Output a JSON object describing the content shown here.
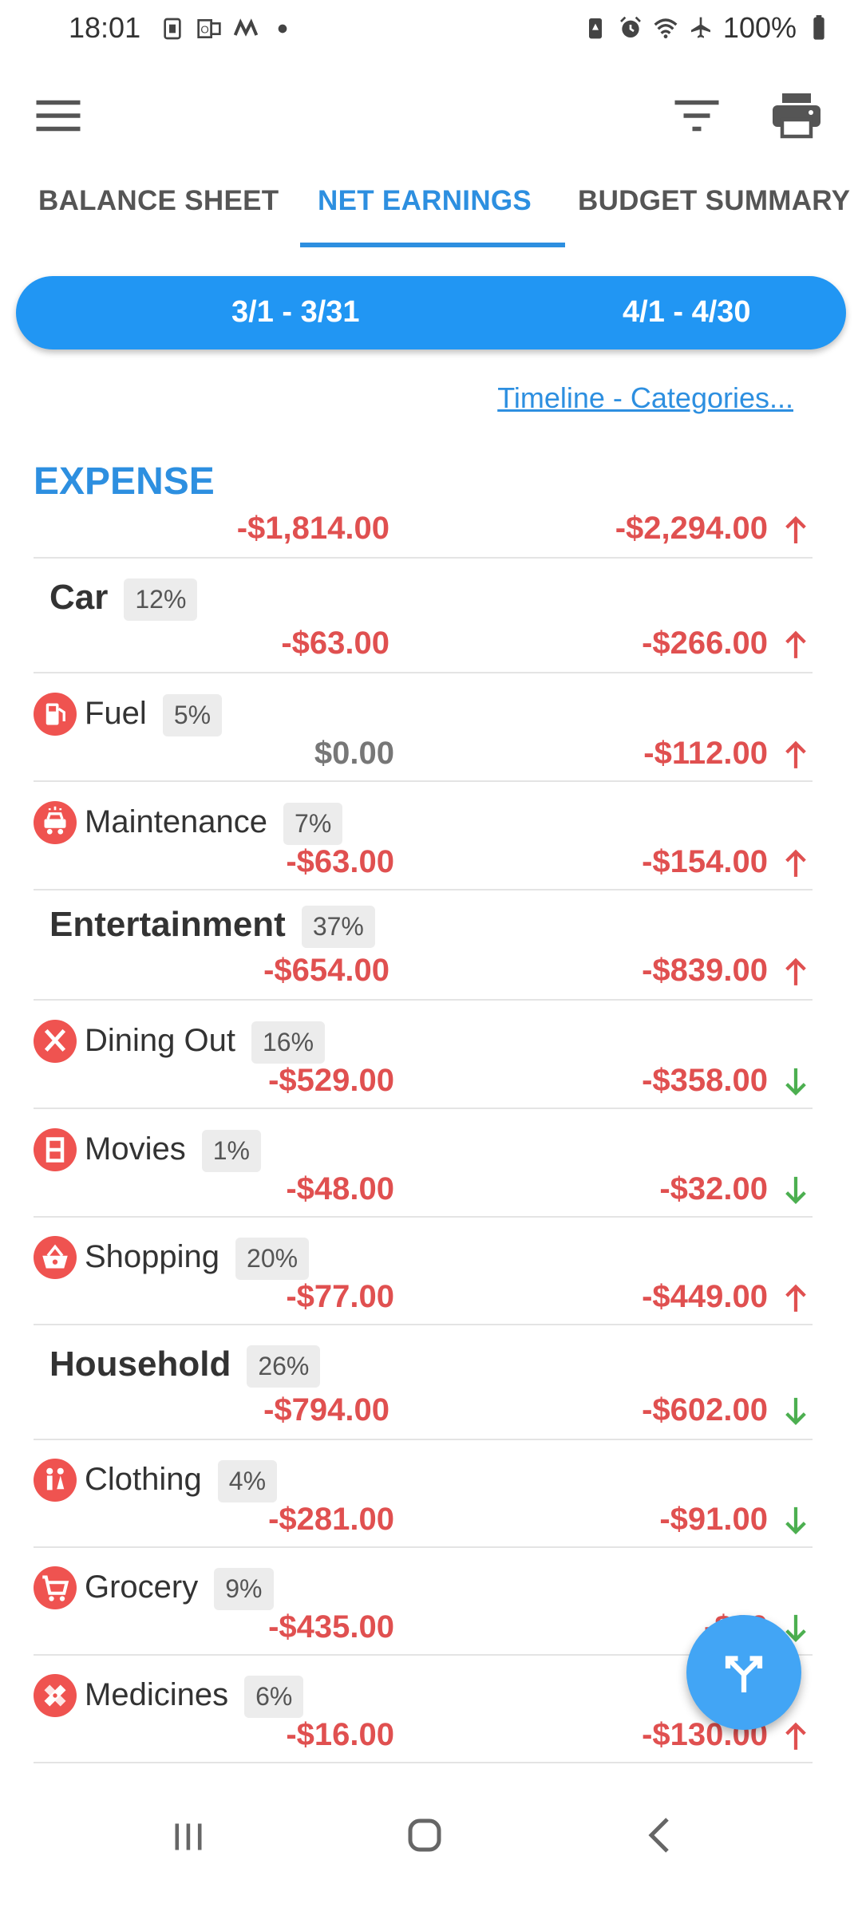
{
  "status_bar": {
    "time": "18:01",
    "battery": "100%",
    "icons": [
      "sim-icon",
      "outlook-icon",
      "m-icon",
      "dot-icon",
      "battery-saver-icon",
      "alarm-icon",
      "wifi-icon",
      "airplane-icon",
      "battery-icon"
    ]
  },
  "toolbar": {
    "menu_icon": "hamburger-menu-icon",
    "filter_icon": "filter-icon",
    "print_icon": "printer-icon"
  },
  "tabs": [
    {
      "label": "BALANCE SHEET",
      "active": false
    },
    {
      "label": "NET EARNINGS",
      "active": true
    },
    {
      "label": "BUDGET SUMMARY",
      "active": false
    }
  ],
  "periods": [
    "3/1 - 3/31",
    "4/1 - 4/30"
  ],
  "timeline_link": "Timeline - Categories...",
  "section": {
    "title": "EXPENSE",
    "total_1": "-$1,814.00",
    "total_2": "-$2,294.00",
    "total_trend": "up"
  },
  "rows": [
    {
      "type": "group",
      "name": "Car",
      "pct": "12%",
      "v1": "-$63.00",
      "v2": "-$266.00",
      "trend": "up"
    },
    {
      "type": "sub",
      "name": "Fuel",
      "icon": "fuel-pump-icon",
      "pct": "5%",
      "v1": "$0.00",
      "v2": "-$112.00",
      "trend": "up"
    },
    {
      "type": "sub",
      "name": "Maintenance",
      "icon": "car-repair-icon",
      "pct": "7%",
      "v1": "-$63.00",
      "v2": "-$154.00",
      "trend": "up"
    },
    {
      "type": "group",
      "name": "Entertainment",
      "pct": "37%",
      "v1": "-$654.00",
      "v2": "-$839.00",
      "trend": "up"
    },
    {
      "type": "sub",
      "name": "Dining Out",
      "icon": "fork-knife-icon",
      "pct": "16%",
      "v1": "-$529.00",
      "v2": "-$358.00",
      "trend": "down"
    },
    {
      "type": "sub",
      "name": "Movies",
      "icon": "film-icon",
      "pct": "1%",
      "v1": "-$48.00",
      "v2": "-$32.00",
      "trend": "down"
    },
    {
      "type": "sub",
      "name": "Shopping",
      "icon": "shopping-basket-icon",
      "pct": "20%",
      "v1": "-$77.00",
      "v2": "-$449.00",
      "trend": "up"
    },
    {
      "type": "group",
      "name": "Household",
      "pct": "26%",
      "v1": "-$794.00",
      "v2": "-$602.00",
      "trend": "down"
    },
    {
      "type": "sub",
      "name": "Clothing",
      "icon": "people-icon",
      "pct": "4%",
      "v1": "-$281.00",
      "v2": "-$91.00",
      "trend": "down"
    },
    {
      "type": "sub",
      "name": "Grocery",
      "icon": "cart-icon",
      "pct": "9%",
      "v1": "-$435.00",
      "v2": "-$20",
      "trend": "down"
    },
    {
      "type": "sub",
      "name": "Medicines",
      "icon": "bandage-icon",
      "pct": "6%",
      "v1": "-$16.00",
      "v2": "-$130.00",
      "trend": "up"
    }
  ],
  "fab_icon": "fork-arrow-icon",
  "nav": [
    "recent-apps-icon",
    "home-icon",
    "back-icon"
  ],
  "colors": {
    "accent": "#2196f3",
    "negative": "#e05050",
    "up_arrow": "#e05050",
    "down_arrow": "#4caf50",
    "category_icon_bg": "#ef5350"
  }
}
